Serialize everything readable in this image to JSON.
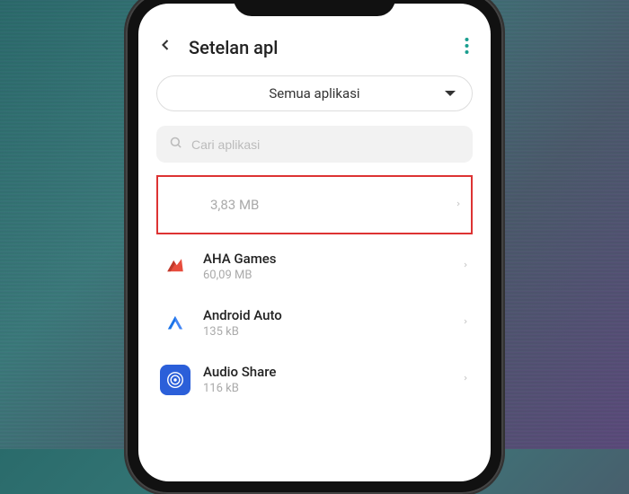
{
  "header": {
    "title": "Setelan apl"
  },
  "filter": {
    "label": "Semua aplikasi"
  },
  "search": {
    "placeholder": "Cari aplikasi"
  },
  "apps": [
    {
      "name": "",
      "size": "3,83 MB"
    },
    {
      "name": "AHA Games",
      "size": "60,09 MB"
    },
    {
      "name": "Android Auto",
      "size": "135 kB"
    },
    {
      "name": "Audio Share",
      "size": "116 kB"
    }
  ]
}
